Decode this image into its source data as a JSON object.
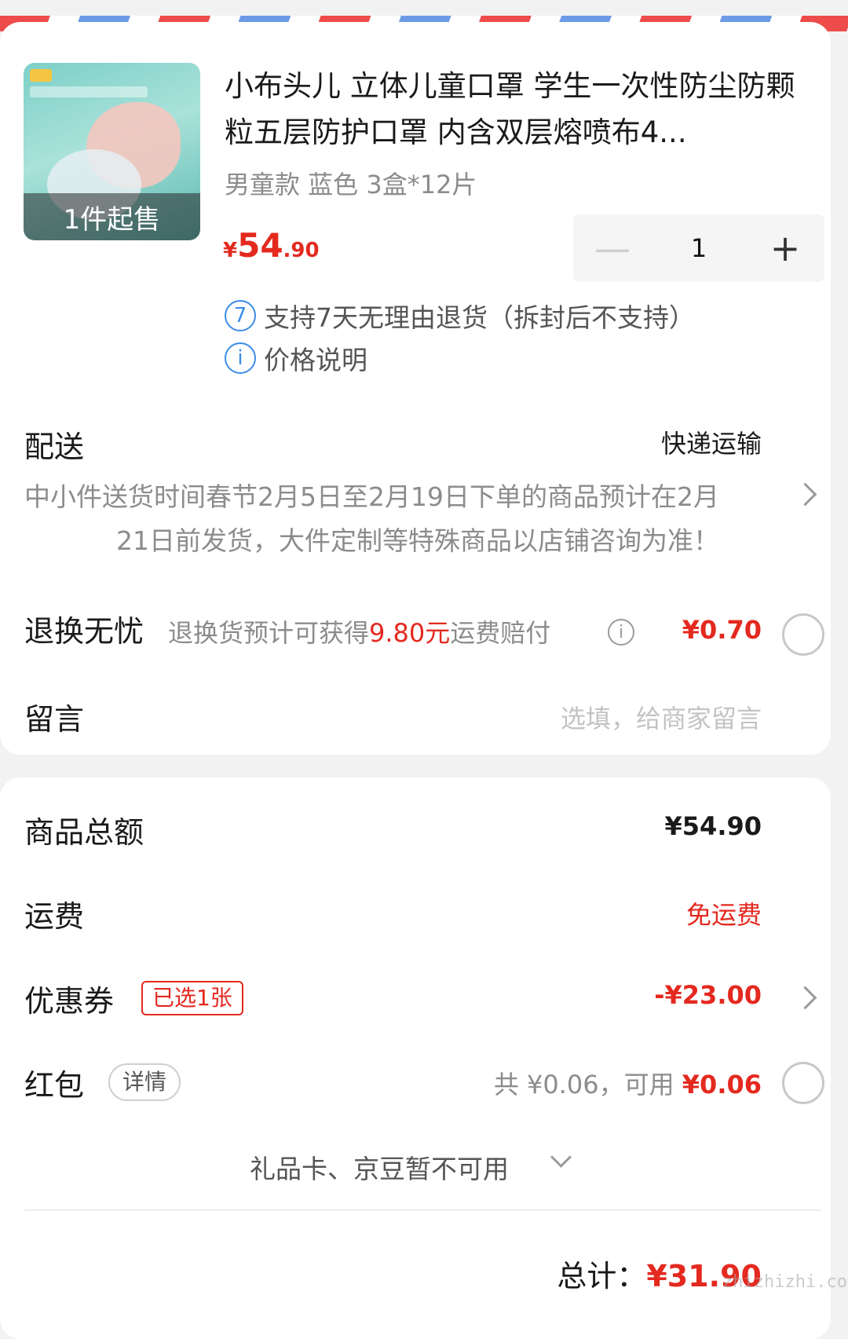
{
  "product": {
    "min_order_badge": "1件起售",
    "title": "小布头儿 立体儿童口罩 学生一次性防尘防颗粒五层防护口罩 内含双层熔喷布4...",
    "spec": "男童款 蓝色 3盒*12片",
    "price_currency": "¥",
    "price_int": "54",
    "price_dec": ".90",
    "quantity": "1",
    "minus_symbol": "—",
    "plus_symbol": "+",
    "services": [
      {
        "icon": "7",
        "text": "支持7天无理由退货（拆封后不支持）"
      },
      {
        "icon": "i",
        "text": "价格说明"
      }
    ]
  },
  "delivery": {
    "label": "配送",
    "method": "快递运输",
    "note_line1": "中小件送货时间春节2月5日至2月19日下单的商品预计在2月",
    "note_line2": "21日前发货，大件定制等特殊商品以店铺咨询为准！"
  },
  "return_service": {
    "label": "退换无忧",
    "desc_prefix": "退换货预计可获得",
    "desc_amount": "9.80元",
    "desc_suffix": "运费赔付",
    "price": "¥0.70"
  },
  "message": {
    "label": "留言",
    "placeholder": "选填，给商家留言"
  },
  "summary": {
    "goods_total_label": "商品总额",
    "goods_total_value": "¥54.90",
    "shipping_label": "运费",
    "shipping_value": "免运费",
    "coupon_label": "优惠券",
    "coupon_tag": "已选1张",
    "coupon_value": "-¥23.00",
    "redpacket_label": "红包",
    "redpacket_detail": "详情",
    "redpacket_total_text": "共 ¥0.06，可用 ",
    "redpacket_available": "¥0.06",
    "giftcard_text": "礼品卡、京豆暂不可用",
    "total_label": "总计：",
    "total_value": "¥31.90"
  },
  "watermark": "zhizhizhi.com",
  "colors": {
    "accent_red": "#e4291f",
    "accent_blue": "#3c8ce7",
    "stripe_red": "#ee4b4b",
    "stripe_blue": "#6d9ae6"
  }
}
